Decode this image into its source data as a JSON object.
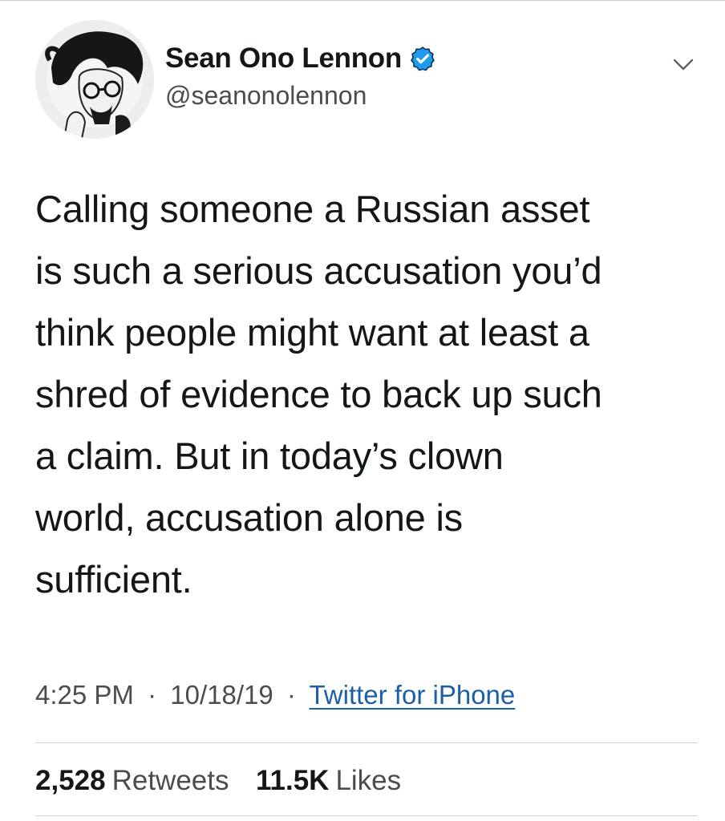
{
  "author": {
    "display_name": "Sean Ono Lennon",
    "handle": "@seanonolennon",
    "verified": true
  },
  "tweet": {
    "text": "Calling someone a Russian asset\nis such a serious accusation you’d\nthink people might want at least a\nshred of evidence to back up such\na claim. But in today’s clown\nworld, accusation alone is\nsufficient."
  },
  "meta": {
    "time": "4:25 PM",
    "separator": "·",
    "date": "10/18/19",
    "source": "Twitter for iPhone"
  },
  "stats": {
    "retweets_count": "2,528",
    "retweets_label": "Retweets",
    "likes_count": "11.5K",
    "likes_label": "Likes"
  },
  "icons": {
    "verified": "verified-badge-icon",
    "menu": "chevron-down-icon",
    "avatar": "profile-avatar"
  },
  "colors": {
    "link": "#1b5fa8",
    "verified_badge": "#1d9bf0",
    "text_primary": "#14171a",
    "text_secondary": "#4a4d50"
  }
}
